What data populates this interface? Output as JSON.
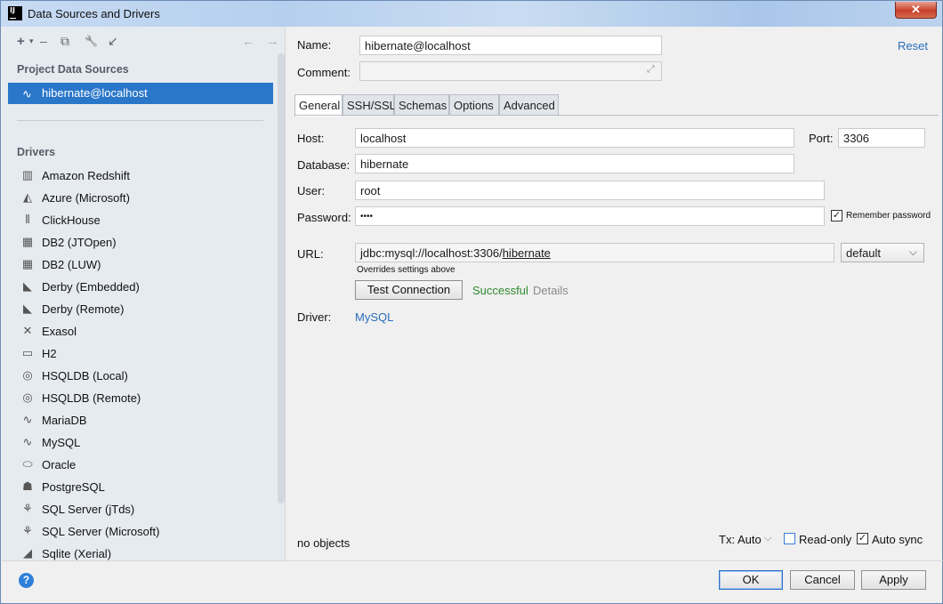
{
  "window": {
    "title": "Data Sources and Drivers",
    "close_label": "✕"
  },
  "toolbar": {
    "add": "+",
    "remove": "–",
    "copy": "⧉",
    "wrench": "🔧",
    "import": "↙",
    "back": "←",
    "forward": "→"
  },
  "left": {
    "project_heading": "Project Data Sources",
    "selected_source": "hibernate@localhost",
    "drivers_heading": "Drivers",
    "drivers": [
      {
        "label": "Amazon Redshift",
        "icon": "▥"
      },
      {
        "label": "Azure (Microsoft)",
        "icon": "◭"
      },
      {
        "label": "ClickHouse",
        "icon": "⦀"
      },
      {
        "label": "DB2 (JTOpen)",
        "icon": "▦"
      },
      {
        "label": "DB2 (LUW)",
        "icon": "▦"
      },
      {
        "label": "Derby (Embedded)",
        "icon": "◣"
      },
      {
        "label": "Derby (Remote)",
        "icon": "◣"
      },
      {
        "label": "Exasol",
        "icon": "✕"
      },
      {
        "label": "H2",
        "icon": "▭"
      },
      {
        "label": "HSQLDB (Local)",
        "icon": "◎"
      },
      {
        "label": "HSQLDB (Remote)",
        "icon": "◎"
      },
      {
        "label": "MariaDB",
        "icon": "∿"
      },
      {
        "label": "MySQL",
        "icon": "∿"
      },
      {
        "label": "Oracle",
        "icon": "⬭"
      },
      {
        "label": "PostgreSQL",
        "icon": "☗"
      },
      {
        "label": "SQL Server (jTds)",
        "icon": "⚘"
      },
      {
        "label": "SQL Server (Microsoft)",
        "icon": "⚘"
      },
      {
        "label": "Sqlite (Xerial)",
        "icon": "◢"
      }
    ]
  },
  "form": {
    "name_label": "Name:",
    "name_value": "hibernate@localhost",
    "comment_label": "Comment:",
    "comment_value": "",
    "reset_label": "Reset",
    "tabs": [
      "General",
      "SSH/SSL",
      "Schemas",
      "Options",
      "Advanced"
    ],
    "host_label": "Host:",
    "host_value": "localhost",
    "port_label": "Port:",
    "port_value": "3306",
    "database_label": "Database:",
    "database_value": "hibernate",
    "user_label": "User:",
    "user_value": "root",
    "password_label": "Password:",
    "password_value": "••••",
    "remember_label": "Remember password",
    "url_label": "URL:",
    "url_prefix": "jdbc:mysql://localhost:3306/",
    "url_db": "hibernate",
    "url_mode": "default",
    "overrides_note": "Overrides settings above",
    "test_button": "Test Connection",
    "test_status": "Successful",
    "details_label": "Details",
    "driver_label": "Driver:",
    "driver_value": "MySQL"
  },
  "footer": {
    "objects_text": "no objects",
    "tx_label": "Tx: Auto",
    "readonly_label": "Read-only",
    "autosync_label": "Auto sync",
    "ok": "OK",
    "cancel": "Cancel",
    "apply": "Apply",
    "help": "?"
  },
  "colors": {
    "accent": "#2a77c9",
    "success": "#2e8b2e",
    "link": "#2a6ebb"
  }
}
